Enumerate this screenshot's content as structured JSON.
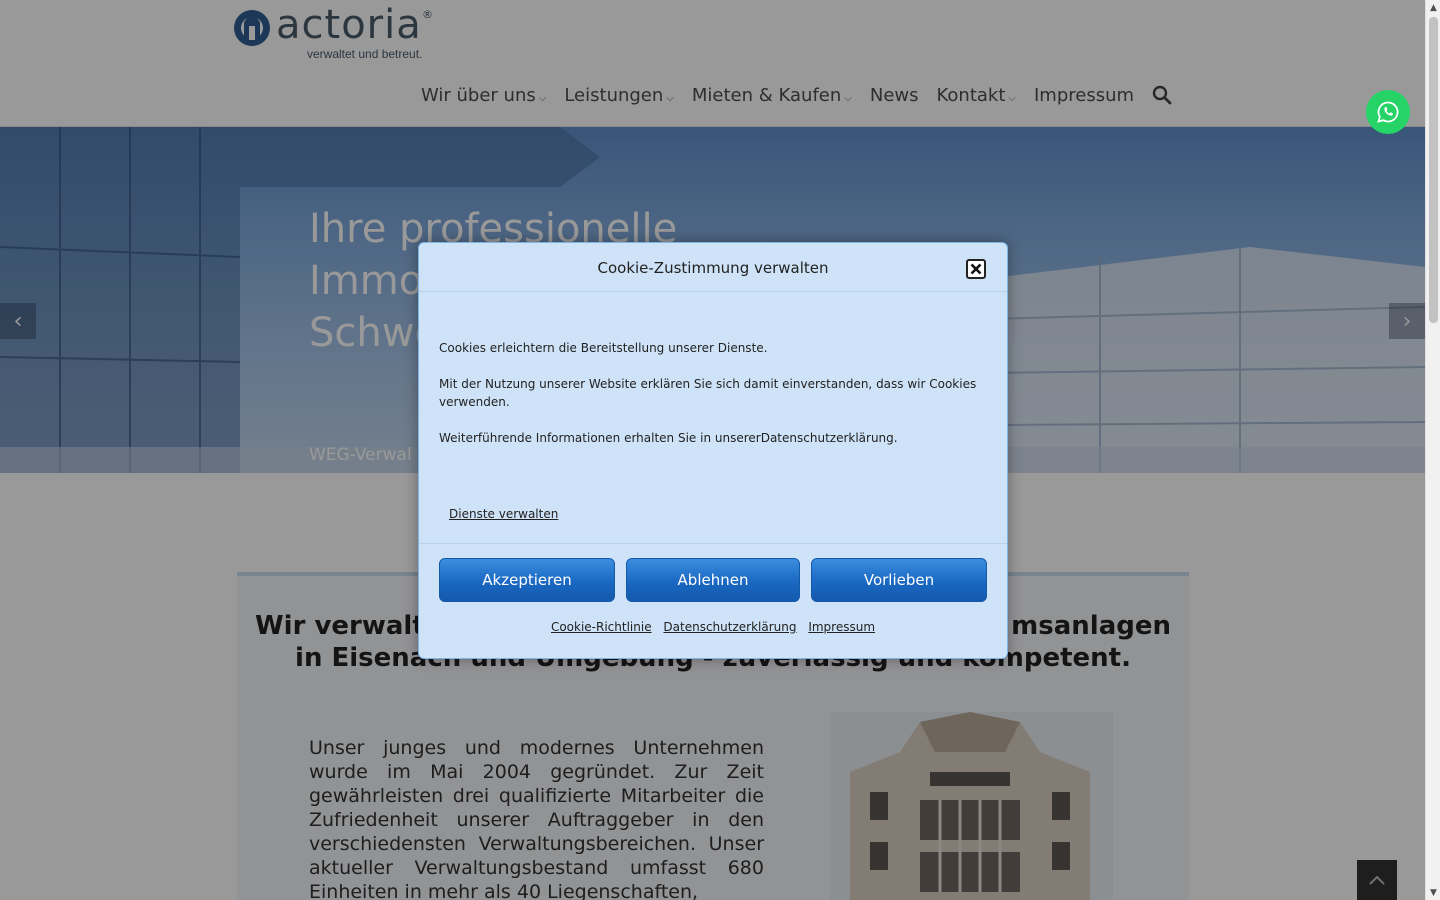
{
  "header": {
    "logo_text": "actoria",
    "logo_reg": "®",
    "logo_tagline": "verwaltet und betreut.",
    "nav": [
      {
        "label": "Wir über uns",
        "dropdown": true
      },
      {
        "label": "Leistungen",
        "dropdown": true
      },
      {
        "label": "Mieten & Kaufen",
        "dropdown": true
      },
      {
        "label": "News",
        "dropdown": false
      },
      {
        "label": "Kontakt",
        "dropdown": true
      },
      {
        "label": "Impressum",
        "dropdown": false
      }
    ],
    "search_icon": "search-icon"
  },
  "whatsapp_icon": "whatsapp-icon",
  "hero": {
    "title_lines": [
      "Ihre professionelle",
      "Immo",
      "Schwe"
    ],
    "subtitle": "WEG-Verwal",
    "prev_arrow": "‹",
    "next_arrow": "›"
  },
  "main": {
    "headline_left_1": "Wir verwalt",
    "headline_right_1": "msanlagen",
    "headline_line_2": "in Eisenach und Umgebung - zuverlässig und kompetent.",
    "intro": "Unser junges und modernes Unternehmen wurde im Mai 2004 gegründet. Zur Zeit gewährleisten drei qualifizierte Mitarbeiter die Zufriedenheit unserer Auftraggeber in den verschiedensten Verwaltungsbereichen. Unser aktueller Verwaltungsbestand umfasst 680 Einheiten in mehr als 40 Liegenschaften,"
  },
  "cookie_modal": {
    "title": "Cookie-Zustimmung verwalten",
    "paragraphs": [
      "Cookies erleichtern die Bereitstellung unserer Dienste.",
      "Mit der Nutzung unserer Website erklären Sie sich damit einverstanden, dass wir Cookies verwenden.",
      "Weiterführende Informationen erhalten Sie in unsererDatenschutzerklärung."
    ],
    "manage_link": "Dienste verwalten",
    "buttons": {
      "accept": "Akzeptieren",
      "deny": "Ablehnen",
      "preferences": "Vorlieben"
    },
    "footer_links": [
      "Cookie-Richtlinie",
      "Datenschutzerklärung",
      "Impressum"
    ]
  },
  "colors": {
    "button_blue": "#1a68c2",
    "modal_bg": "#cfe3f8",
    "whatsapp_green": "#25d366",
    "overlay": "rgba(0,0,0,0.4)"
  }
}
